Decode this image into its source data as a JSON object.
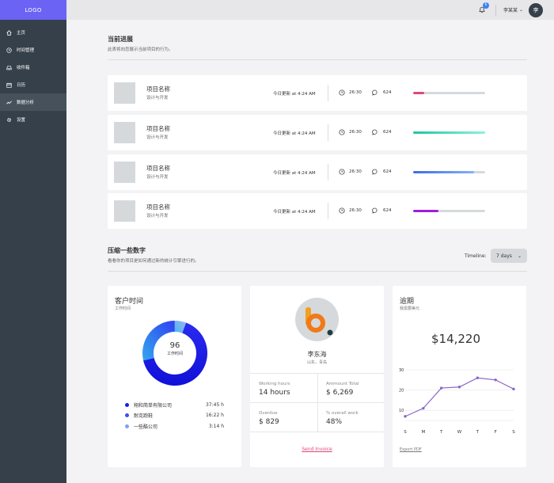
{
  "logo": "LOGO",
  "sidebar": {
    "items": [
      {
        "label": "主页",
        "icon": "home-icon"
      },
      {
        "label": "时间管理",
        "icon": "clock-icon"
      },
      {
        "label": "收件箱",
        "icon": "inbox-icon"
      },
      {
        "label": "日历",
        "icon": "calendar-icon"
      },
      {
        "label": "数据分析",
        "icon": "chart-icon",
        "active": true
      },
      {
        "label": "设置",
        "icon": "gear-icon"
      }
    ]
  },
  "header": {
    "notification_count": "6",
    "user_name": "李某某",
    "avatar_initial": "李"
  },
  "progress_section": {
    "title": "当前进展",
    "subtitle": "此表将向您展示当前项目的行为。"
  },
  "projects": [
    {
      "name": "项目名称",
      "category": "设计与开发",
      "updated": "今日更新 at 4:24 AM",
      "time": "26:30",
      "comments": "624",
      "progress": 0.15,
      "bar_color": "#e0457b"
    },
    {
      "name": "项目名称",
      "category": "设计与开发",
      "updated": "今日更新 at 4:24 AM",
      "time": "26:30",
      "comments": "624",
      "progress": 1.0,
      "bar_color": "teal-gradient"
    },
    {
      "name": "项目名称",
      "category": "设计与开发",
      "updated": "今日更新 at 4:24 AM",
      "time": "26:30",
      "comments": "624",
      "progress": 0.85,
      "bar_color": "blue-gradient"
    },
    {
      "name": "项目名称",
      "category": "设计与开发",
      "updated": "今日更新 at 4:24 AM",
      "time": "26:30",
      "comments": "624",
      "progress": 0.35,
      "bar_color": "#9b1fe0"
    }
  ],
  "numbers_section": {
    "title": "压缩一些数字",
    "subtitle": "看看你的项目是如何通过新的统计引擎进行的。",
    "timeline_label": "Timeline:",
    "timeline_value": "7 days"
  },
  "customer_time": {
    "title": "客户时间",
    "subtitle": "工作时间",
    "center_value": "96",
    "center_label": "工作时间",
    "legend": [
      {
        "name": "翔和简单有限公司",
        "value": "37:45 h",
        "color": "#1c1ce6"
      },
      {
        "name": "耐克跑鞋",
        "value": "16:22 h",
        "color": "#3d4df5"
      },
      {
        "name": "一些酷公司",
        "value": "3:14 h",
        "color": "#7da2f0"
      }
    ],
    "chart_data": {
      "type": "pie",
      "categories": [
        "翔和简单有限公司",
        "耐克跑鞋",
        "一些酷公司"
      ],
      "values": [
        37.75,
        16.37,
        3.23
      ]
    }
  },
  "profile": {
    "name": "李东海",
    "location": "山东，青岛",
    "stats": [
      {
        "label": "Working hours",
        "value": "14 hours"
      },
      {
        "label": "Ammount Total",
        "value": "$ 6,269"
      },
      {
        "label": "Overdue",
        "value": "$ 829"
      },
      {
        "label": "% overall work",
        "value": "48%"
      }
    ],
    "send_link": "Send Invoice"
  },
  "overdue": {
    "title": "逾期",
    "subtitle": "我需要美元",
    "amount": "$14,220",
    "export_link": "Export PDF",
    "chart_data": {
      "type": "line",
      "categories": [
        "S",
        "M",
        "T",
        "W",
        "T",
        "F",
        "S"
      ],
      "values": [
        7,
        11,
        21,
        21.5,
        26,
        25,
        20.5
      ],
      "ylim": [
        5,
        30
      ],
      "yticks": [
        "30",
        "20",
        "10"
      ],
      "line_color": "#8a66c9"
    }
  }
}
